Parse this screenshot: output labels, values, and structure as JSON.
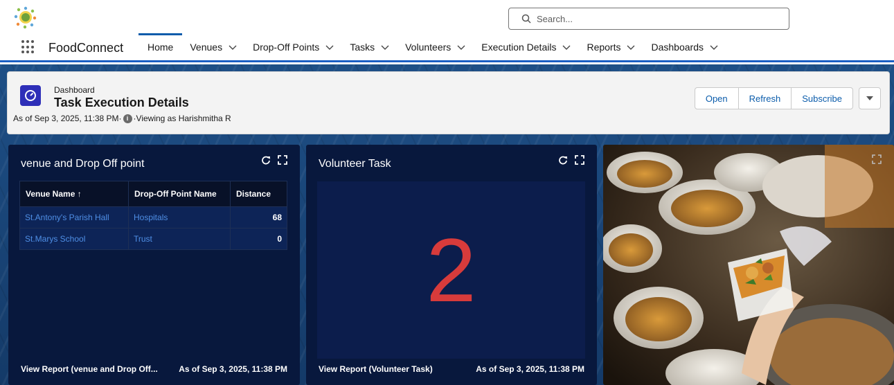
{
  "header": {
    "logo_icon": "foodconnect-logo",
    "search_placeholder": "Search..."
  },
  "nav": {
    "app_name": "FoodConnect",
    "tabs": [
      {
        "label": "Home",
        "active": true,
        "has_menu": false
      },
      {
        "label": "Venues",
        "active": false,
        "has_menu": true
      },
      {
        "label": "Drop-Off Points",
        "active": false,
        "has_menu": true
      },
      {
        "label": "Tasks",
        "active": false,
        "has_menu": true
      },
      {
        "label": "Volunteers",
        "active": false,
        "has_menu": true
      },
      {
        "label": "Execution Details",
        "active": false,
        "has_menu": true
      },
      {
        "label": "Reports",
        "active": false,
        "has_menu": true
      },
      {
        "label": "Dashboards",
        "active": false,
        "has_menu": true
      }
    ]
  },
  "dashboard": {
    "type_label": "Dashboard",
    "title": "Task Execution Details",
    "as_of": "As of Sep 3, 2025, 11:38 PM·",
    "viewing_as": "·Viewing as Harishmitha R",
    "buttons": {
      "open": "Open",
      "refresh": "Refresh",
      "subscribe": "Subscribe"
    }
  },
  "widgets": {
    "table": {
      "title": "venue and Drop Off point",
      "columns": [
        "Venue Name ↑",
        "Drop-Off Point Name",
        "Distance"
      ],
      "rows": [
        {
          "venue": "St.Antony's Parish Hall",
          "drop_off": "Hospitals",
          "distance": "68"
        },
        {
          "venue": "St.Marys School",
          "drop_off": "Trust",
          "distance": "0"
        }
      ],
      "footer_link": "View Report (venue and Drop Off...",
      "footer_time": "As of Sep 3, 2025, 11:38 PM"
    },
    "metric": {
      "title": "Volunteer Task",
      "value": "2",
      "footer_link": "View Report (Volunteer Task)",
      "footer_time": "As of Sep 3, 2025, 11:38 PM"
    }
  },
  "colors": {
    "brand_blue": "#0b5cab",
    "dashboard_icon": "#2e2fb8",
    "widget_bg": "#08183d",
    "metric_value": "#d73b3b"
  }
}
